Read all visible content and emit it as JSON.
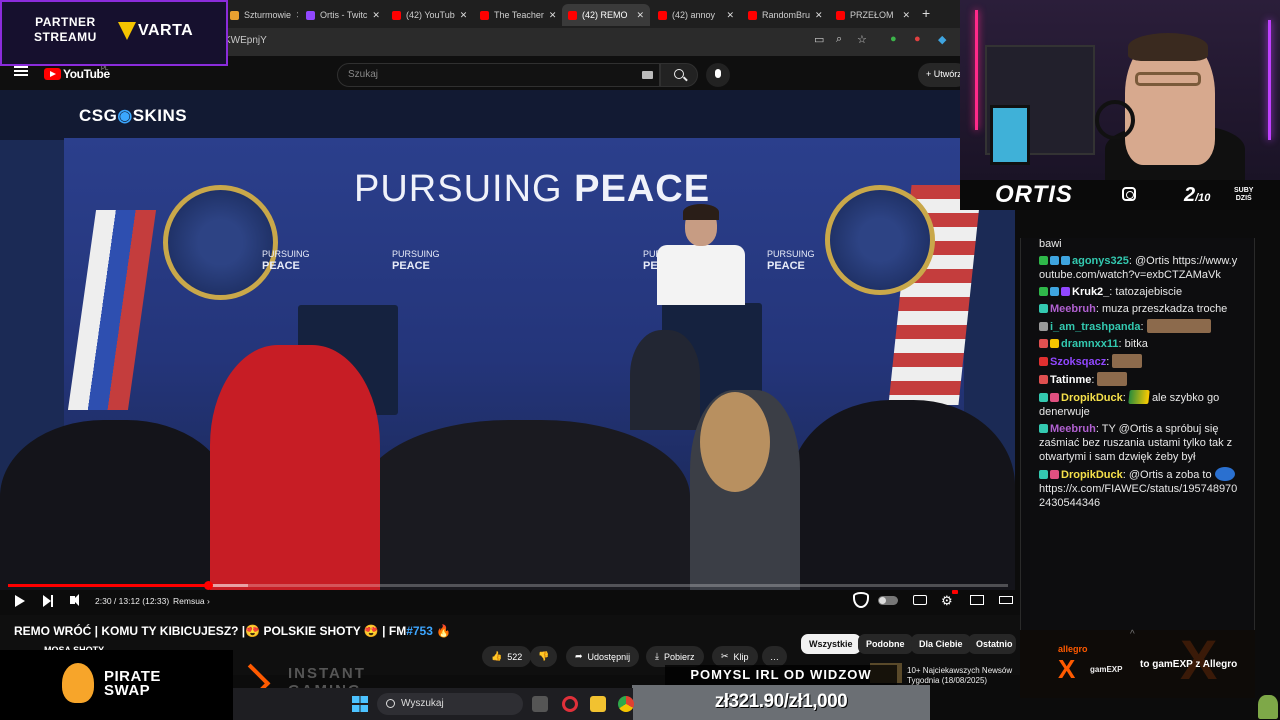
{
  "browser": {
    "tabs": [
      {
        "label": "Szturmowie",
        "color": "#e8a030"
      },
      {
        "label": "Ortis - Twitc",
        "color": "#9147ff"
      },
      {
        "label": "(42) YouTub",
        "color": "#ff0000"
      },
      {
        "label": "The Teacher",
        "color": "#ff0000"
      },
      {
        "label": "(42) REMO",
        "color": "#ff0000"
      },
      {
        "label": "(42) annoy",
        "color": "#ff0000"
      },
      {
        "label": "RandomBru",
        "color": "#ff0000"
      },
      {
        "label": "PRZEŁOM",
        "color": "#ff0000"
      }
    ],
    "active_tab_index": 4,
    "close_glyph": "✕",
    "new_tab_glyph": "+",
    "url_fragment": "KWEpnjY"
  },
  "youtube": {
    "logo_text": "YouTube",
    "logo_region": "PL",
    "search_placeholder": "Szukaj",
    "create_label": "Utwórz",
    "create_icon": "+"
  },
  "video": {
    "sponsor_logo": {
      "left": "CSG",
      "right": "SKINS",
      "mark": "◉"
    },
    "backdrop_text": {
      "light": "PURSUING",
      "bold": "PEACE"
    },
    "small_banner": {
      "line1": "PURSUING",
      "line2": "PEACE"
    },
    "time": "2:30 / 13:12 (12:33)",
    "chapter": "Remsua",
    "chapter_arrow": "›",
    "progress": {
      "played": 0.2,
      "buffered": 0.24
    }
  },
  "title_bar": {
    "title_prefix": "REMO WRÓĆ | KOMU TY KIBICUJESZ? |😍 POLSKIE SHOTY 😍 | FM",
    "title_tag": "#753",
    "title_suffix": " 🔥",
    "channel": "MOSA SHOTY",
    "likes": "522",
    "share": "Udostępnij",
    "download": "Pobierz",
    "clip": "Klip",
    "more": "…",
    "chips": [
      "Wszystkie",
      "Podobne",
      "Dla Ciebie",
      "Ostatnio"
    ],
    "recommendation": {
      "line1": "10+ Najciekawszych Newsów",
      "line2": "Tygodnia (18/08/2025)"
    }
  },
  "overlays": {
    "partner_line1": "PARTNER",
    "partner_line2": "STREAMU",
    "varta": "VARTA",
    "pirateswap_line1": "PIRATE",
    "pirateswap_line2": "SWAP",
    "instant_line1": "INSTANT",
    "instant_line2": "GAMING",
    "pomysl": "POMYSL IRL OD WIDZOW",
    "goal": "zł321.90/zł1,000"
  },
  "taskbar": {
    "search_label": "Wyszukaj"
  },
  "webcam": {
    "streamer": "ORTIS",
    "sub_count": "2",
    "sub_goal": "/10",
    "subs_line1": "SUBY",
    "subs_line2": "DZIŚ"
  },
  "chat": {
    "messages": [
      {
        "user": "",
        "color": "#ffffff",
        "badges": [],
        "text": "bawi"
      },
      {
        "user": "agonys325",
        "color": "#33c9b0",
        "badges": [
          "#2fb84a",
          "#3fa5e0",
          "#3fa5e0"
        ],
        "text": "@Ortis https://www.youtube.com/watch?v=exbCTZAMaVk"
      },
      {
        "user": "Kruk2_",
        "color": "#ffffff",
        "badges": [
          "#2fb84a",
          "#3fa5e0",
          "#9147ff"
        ],
        "text": "tatozajebiscie"
      },
      {
        "user": "Meebruh",
        "color": "#b060d0",
        "badges": [
          "#33c9b0"
        ],
        "text": "muza przeszkadza troche"
      },
      {
        "user": "i_am_trashpanda",
        "color": "#33c9b0",
        "badges": [
          "#999999"
        ],
        "text": "",
        "emote": "wide"
      },
      {
        "user": "dramnxx11",
        "color": "#33c9b0",
        "badges": [
          "#e05050",
          "#f5c400"
        ],
        "text": "bitka"
      },
      {
        "user": "Szoksqacz",
        "color": "#9147ff",
        "badges": [
          "#e03030"
        ],
        "text": "",
        "emote": "normal"
      },
      {
        "user": "Tatinme",
        "color": "#ffffff",
        "badges": [
          "#e05050"
        ],
        "text": "",
        "emote": "normal"
      },
      {
        "user": "DropikDuck",
        "color": "#f5e04a",
        "badges": [
          "#33c9b0",
          "#e05080"
        ],
        "text": "ale szybko go denerwuje",
        "emote": "flag"
      },
      {
        "user": "Meebruh",
        "color": "#b060d0",
        "badges": [
          "#33c9b0"
        ],
        "text": "TY @Ortis a spróbuj się zaśmiać bez ruszania ustami tylko tak z otwartymi i sam dzwięk żeby był"
      },
      {
        "user": "DropikDuck",
        "color": "#f5e04a",
        "badges": [
          "#33c9b0",
          "#e05080"
        ],
        "text": "@Ortis a zoba to",
        "emote": "blue",
        "extra": "https://x.com/FIAWEC/status/1957489702430544346"
      }
    ]
  },
  "allegro": {
    "logo": "allegro",
    "brand_x": "X",
    "brand": "gamEXP",
    "caption": "to gamEXP z Allegro",
    "big_x": "X",
    "caret": "^"
  }
}
